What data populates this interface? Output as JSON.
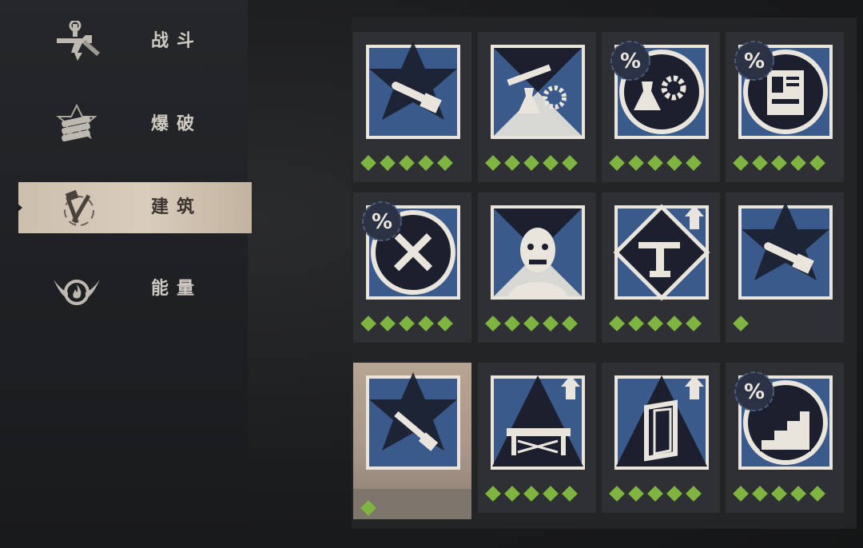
{
  "sidebar": {
    "categories": [
      {
        "label": "战斗",
        "icon": "pistol-wrench-icon",
        "active": false
      },
      {
        "label": "爆破",
        "icon": "dynamite-icon",
        "active": false
      },
      {
        "label": "建筑",
        "icon": "hammer-crossed-icon",
        "active": true
      },
      {
        "label": "能量",
        "icon": "winged-flame-icon",
        "active": false
      }
    ]
  },
  "colors": {
    "accent_green": "#7eb440",
    "tile_blue": "#3a5a8c",
    "tile_frame": "#e9e5dc",
    "active_tab": "#d8ccbc"
  },
  "perks": [
    {
      "icon": "chainsaw-drill-icon",
      "rank": 5,
      "shape": "star",
      "discount": false,
      "upgrade": false
    },
    {
      "icon": "wrench-flask-gear-icon",
      "rank": 5,
      "shape": "hourglass",
      "discount": false,
      "upgrade": false
    },
    {
      "icon": "flask-gear-icon",
      "rank": 5,
      "shape": "circle",
      "discount": true,
      "upgrade": false
    },
    {
      "icon": "blueprint-icon",
      "rank": 5,
      "shape": "circle",
      "discount": true,
      "upgrade": false
    },
    {
      "icon": "wrench-screwdriver-icon",
      "rank": 5,
      "shape": "circle",
      "discount": true,
      "upgrade": false
    },
    {
      "icon": "zombie-head-icon",
      "rank": 5,
      "shape": "hourglass",
      "discount": false,
      "upgrade": false
    },
    {
      "icon": "turret-icon",
      "rank": 5,
      "shape": "diamond",
      "discount": false,
      "upgrade": true
    },
    {
      "icon": "chainsaw-blueprint-icon",
      "rank": 1,
      "shape": "star",
      "discount": false,
      "upgrade": false
    },
    {
      "icon": "nail-gun-blueprint-icon",
      "rank": 1,
      "shape": "star",
      "discount": false,
      "upgrade": false,
      "selected": true
    },
    {
      "icon": "workbench-icon",
      "rank": 5,
      "shape": "triangle",
      "discount": false,
      "upgrade": true
    },
    {
      "icon": "door-frame-icon",
      "rank": 5,
      "shape": "triangle",
      "discount": false,
      "upgrade": true
    },
    {
      "icon": "stairs-icon",
      "rank": 5,
      "shape": "circle",
      "discount": true,
      "upgrade": false
    }
  ],
  "discount_symbol": "%"
}
